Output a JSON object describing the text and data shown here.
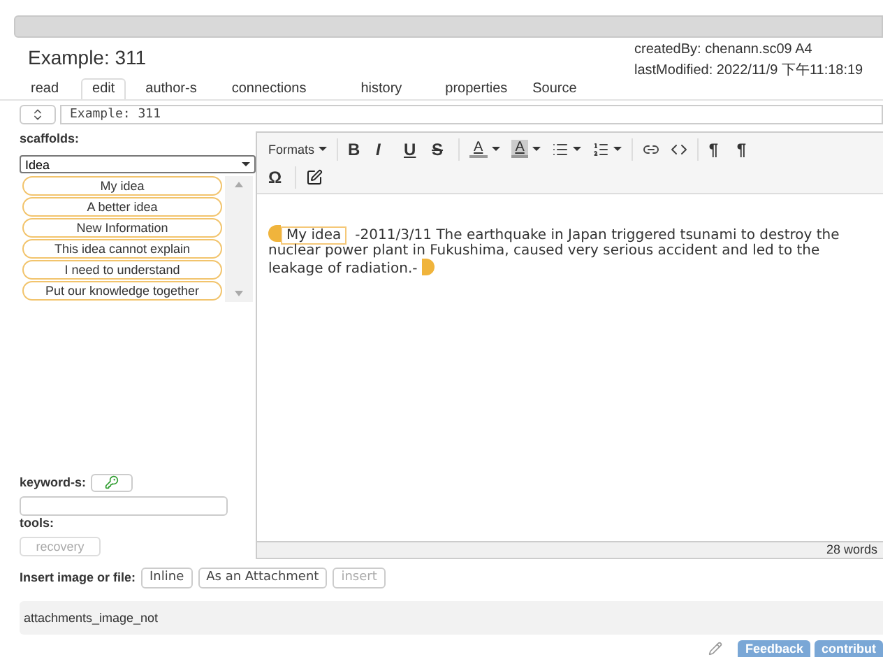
{
  "header": {
    "title": "Example: 311",
    "created_by": "createdBy: chenann.sc09 A4",
    "last_modified": "lastModified: 2022/11/9 下午11:18:19"
  },
  "tabs": [
    {
      "label": "read",
      "selected": false
    },
    {
      "label": "edit",
      "selected": true
    },
    {
      "label": "author-s",
      "selected": false
    },
    {
      "label": "connections",
      "selected": false
    },
    {
      "label": "history",
      "selected": false
    },
    {
      "label": "properties",
      "selected": false
    },
    {
      "label": "Source",
      "selected": false
    }
  ],
  "title_field": {
    "value": "Example: 311"
  },
  "scaffolds": {
    "label": "scaffolds:",
    "select": "Idea",
    "items": [
      "My idea",
      "A better idea",
      "New Information",
      "This idea cannot explain",
      "I need to understand",
      "Put our knowledge together"
    ]
  },
  "toolbar": {
    "formats": "Formats",
    "text_buttons": [
      "B",
      "I",
      "U",
      "S"
    ],
    "color_buttons": [
      "A",
      "A"
    ],
    "direction_buttons": [
      "¶",
      "¶"
    ],
    "symbol": "Ω"
  },
  "content": {
    "scaffold": "My idea",
    "text": "-2011/3/11 The earthquake in Japan triggered tsunami to destroy the nuclear power plant in Fukushima, caused very serious accident and led to the leakage of radiation.-"
  },
  "status": "28 words",
  "keywords": {
    "label": "keyword-s:"
  },
  "tools": {
    "label": "tools:",
    "button": "recovery"
  },
  "insert": {
    "label": "Insert image or file:",
    "buttons": [
      {
        "label": "Inline",
        "disabled": false
      },
      {
        "label": "As an Attachment",
        "disabled": false
      },
      {
        "label": "insert",
        "disabled": true
      }
    ]
  },
  "attachments": "attachments_image_not",
  "footer_buttons": [
    "Feedback",
    "contribut"
  ]
}
